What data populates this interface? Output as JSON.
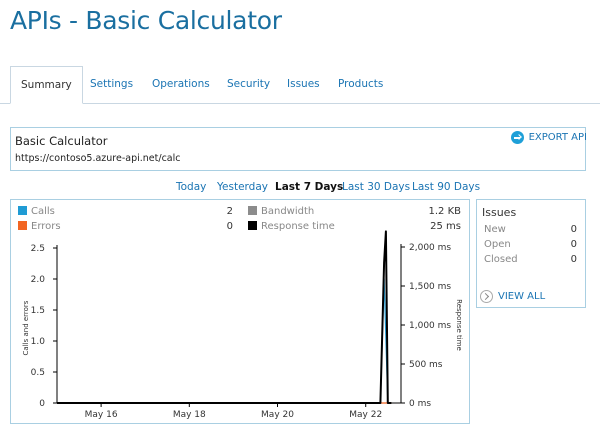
{
  "page": {
    "title": "APIs - Basic Calculator"
  },
  "tabs": [
    {
      "label": "Summary",
      "active": true
    },
    {
      "label": "Settings"
    },
    {
      "label": "Operations"
    },
    {
      "label": "Security"
    },
    {
      "label": "Issues"
    },
    {
      "label": "Products"
    }
  ],
  "api": {
    "name": "Basic Calculator",
    "url": "https://contoso5.azure-api.net/calc",
    "export_label": "EXPORT API"
  },
  "time_ranges": [
    {
      "label": "Today"
    },
    {
      "label": "Yesterday"
    },
    {
      "label": "Last 7 Days",
      "selected": true
    },
    {
      "label": "Last 30 Days"
    },
    {
      "label": "Last 90 Days"
    }
  ],
  "metrics": {
    "calls": {
      "label": "Calls",
      "value": "2",
      "color": "#1f9bd4"
    },
    "errors": {
      "label": "Errors",
      "value": "0",
      "color": "#f26522"
    },
    "bandwidth": {
      "label": "Bandwidth",
      "value": "1.2 KB",
      "color": "#8c8c8c"
    },
    "response_time": {
      "label": "Response time",
      "value": "25 ms",
      "color": "#000000"
    }
  },
  "issues": {
    "title": "Issues",
    "rows": [
      {
        "label": "New",
        "value": "0"
      },
      {
        "label": "Open",
        "value": "0"
      },
      {
        "label": "Closed",
        "value": "0"
      }
    ],
    "view_all_label": "VIEW ALL"
  },
  "chart_data": {
    "type": "line",
    "ylabel": "Calls and errors",
    "y2label": "Response time",
    "ylim": [
      0,
      2.5
    ],
    "y2lim": [
      0,
      2000
    ],
    "yticks": [
      "0",
      "0.5",
      "1.0",
      "1.5",
      "2.0",
      "2.5"
    ],
    "y2ticks": [
      "0 ms",
      "500 ms",
      "1,000 ms",
      "1,500 ms",
      "2,000 ms"
    ],
    "xticks": [
      "May 16",
      "May 18",
      "May 20",
      "May 22"
    ],
    "grid": false,
    "series": [
      {
        "name": "Calls",
        "color": "#1f9bd4",
        "axis": "left",
        "x": [
          "May 15",
          "May 22 08:00",
          "May 22 10:00",
          "May 22 12:00",
          "May 22 14:00"
        ],
        "values": [
          0,
          0,
          2,
          0,
          0
        ]
      },
      {
        "name": "Errors",
        "color": "#f26522",
        "axis": "left",
        "x": [
          "May 15",
          "May 22 08:00",
          "May 22 10:00",
          "May 22 14:00"
        ],
        "values": [
          0,
          0,
          0,
          0
        ]
      },
      {
        "name": "Response time",
        "color": "#000000",
        "axis": "right",
        "x": [
          "May 15",
          "May 22 08:00",
          "May 22 10:00",
          "May 22 11:00",
          "May 22 12:00",
          "May 22 14:00"
        ],
        "values": [
          0,
          0,
          1800,
          2200,
          0,
          0
        ]
      }
    ]
  }
}
